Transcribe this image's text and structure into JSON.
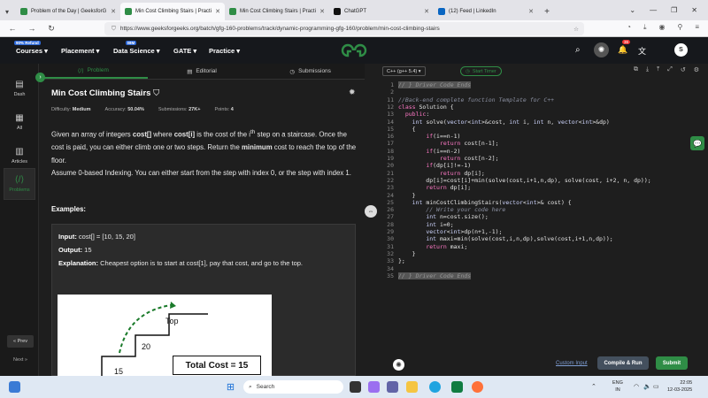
{
  "browser": {
    "tabs": [
      {
        "label": "Problem of the Day | GeeksforG",
        "color": "#2f8d46"
      },
      {
        "label": "Min Cost Climbing Stairs | Practi",
        "color": "#2f8d46",
        "active": true
      },
      {
        "label": "Min Cost Climbing Stairs | Practi",
        "color": "#2f8d46"
      },
      {
        "label": "ChatGPT",
        "color": "#111"
      },
      {
        "label": "(12) Feed | LinkedIn",
        "color": "#0a66c2"
      }
    ],
    "url": "https://www.geeksforgeeks.org/batch/gfg-160-problems/track/dynamic-programming-gfg-160/problem/min-cost-climbing-stairs"
  },
  "gfg_header": {
    "menu": [
      "Courses",
      "Placement",
      "Data Science",
      "GATE",
      "Practice"
    ],
    "courses_badge": "90% Refund",
    "ds_badge": "IBM",
    "logo": "GfG",
    "notifications": "36",
    "avatar": "S"
  },
  "rail": {
    "items": [
      "Dash",
      "All",
      "Articles",
      "Problems"
    ],
    "prev": "« Prev",
    "next": "Next »"
  },
  "problem": {
    "tabs": [
      "Problem",
      "Editorial",
      "Submissions"
    ],
    "title": "Min Cost Climbing Stairs",
    "difficulty_label": "Difficulty:",
    "difficulty": "Medium",
    "accuracy_label": "Accuracy:",
    "accuracy": "50.04%",
    "submissions_label": "Submissions:",
    "submissions": "27K+",
    "points_label": "Points:",
    "points": "4",
    "desc_1a": "Given an array of integers ",
    "desc_1b": "cost[]",
    "desc_1c": " where ",
    "desc_1d": "cost[i]",
    "desc_1e": " is the cost of the i",
    "desc_1sup": "th",
    "desc_1f": " step on a staircase. Once the cost is paid, you can either climb one or two steps. Return the ",
    "desc_1g": "minimum",
    "desc_1h": " cost to reach the top of the floor.",
    "desc_2": "Assume 0-based Indexing. You can either start from the step with index 0, or the step with index 1.",
    "examples_heading": "Examples:",
    "input_label": "Input:",
    "input": "cost[] = [10, 15, 20]",
    "output_label": "Output:",
    "output": "15",
    "explanation_label": "Explanation:",
    "explanation": "Cheapest option is to start at cost[1], pay that cost, and go to the top.",
    "figure": {
      "top": "Top",
      "step20": "20",
      "step15": "15",
      "total": "Total Cost = 15"
    }
  },
  "editor": {
    "language": "C++ (g++ 5.4)",
    "timer": "Start Timer",
    "lines": [
      {
        "n": "1",
        "t": "// } Driver Code Ends",
        "c": "cm",
        "hl": true
      },
      {
        "n": "2",
        "t": ""
      },
      {
        "n": "11",
        "t": "//Back-end complete function Template for C++",
        "c": "cm"
      },
      {
        "n": "12",
        "t": "class Solution {"
      },
      {
        "n": "13",
        "t": "  public:"
      },
      {
        "n": "14",
        "t": "    int solve(vector<int>&cost, int i, int n, vector<int>&dp)"
      },
      {
        "n": "15",
        "t": "    {"
      },
      {
        "n": "16",
        "t": "        if(i==n-1)"
      },
      {
        "n": "17",
        "t": "            return cost[n-1];"
      },
      {
        "n": "18",
        "t": "        if(i==n-2)"
      },
      {
        "n": "19",
        "t": "            return cost[n-2];"
      },
      {
        "n": "20",
        "t": "        if(dp[i]!=-1)"
      },
      {
        "n": "21",
        "t": "            return dp[i];"
      },
      {
        "n": "22",
        "t": "        dp[i]=cost[i]+min(solve(cost,i+1,n,dp), solve(cost, i+2, n, dp));"
      },
      {
        "n": "23",
        "t": "        return dp[i];"
      },
      {
        "n": "24",
        "t": "    }"
      },
      {
        "n": "25",
        "t": "    int minCostClimbingStairs(vector<int>& cost) {"
      },
      {
        "n": "26",
        "t": "        // Write your code here",
        "c": "cm"
      },
      {
        "n": "27",
        "t": "        int n=cost.size();"
      },
      {
        "n": "28",
        "t": "        int i=0;"
      },
      {
        "n": "29",
        "t": "        vector<int>dp(n+1,-1);"
      },
      {
        "n": "30",
        "t": "        int maxi=min(solve(cost,i,n,dp),solve(cost,i+1,n,dp));"
      },
      {
        "n": "31",
        "t": "        return maxi;"
      },
      {
        "n": "32",
        "t": "    }"
      },
      {
        "n": "33",
        "t": "};"
      },
      {
        "n": "34",
        "t": ""
      },
      {
        "n": "35",
        "t": "// } Driver Code Ends",
        "c": "cm",
        "hl": true
      }
    ],
    "custom_input": "Custom Input",
    "compile": "Compile & Run",
    "submit": "Submit"
  },
  "taskbar": {
    "search": "Search",
    "lang1": "ENG",
    "lang2": "IN",
    "time": "22:05",
    "date": "12-03-2025"
  }
}
